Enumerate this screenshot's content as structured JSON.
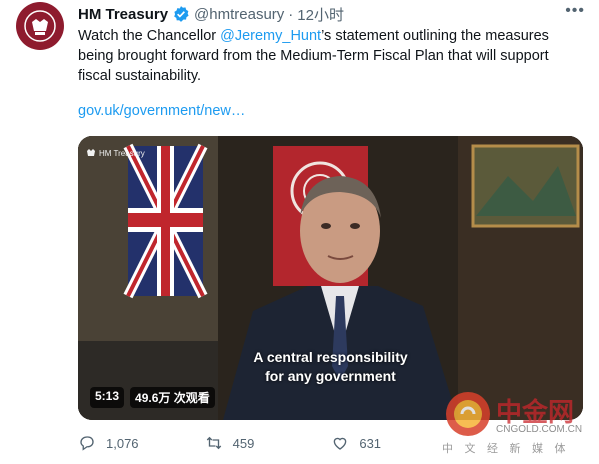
{
  "tweet": {
    "account_name": "HM Treasury",
    "handle": "@hmtreasury",
    "separator": "·",
    "time": "12小时",
    "text_before": "Watch the Chancellor ",
    "mention": "@Jeremy_Hunt",
    "text_after": "’s statement outlining the measures being brought forward from the Medium-Term Fiscal Plan that will support fiscal sustainability.",
    "link": "gov.uk/government/new…"
  },
  "media": {
    "logo_text": "HM Treasury",
    "caption_line1": "A central responsibility",
    "caption_line2": "for any government",
    "duration": "5:13",
    "views": "49.6万 次观看"
  },
  "actions": {
    "replies": "1,076",
    "retweets": "459",
    "likes": "631"
  },
  "watermark": {
    "brand": "中金网",
    "domain": "CNGOLD.COM.CN",
    "tagline": "中 文 经 新 媒 体"
  },
  "colors": {
    "accent": "#1d9bf0",
    "text_secondary": "#536471",
    "avatar_bg": "#8e1b2e"
  },
  "icons": [
    "crest-icon",
    "verified-badge-icon",
    "more-icon",
    "reply-icon",
    "retweet-icon",
    "like-icon"
  ]
}
